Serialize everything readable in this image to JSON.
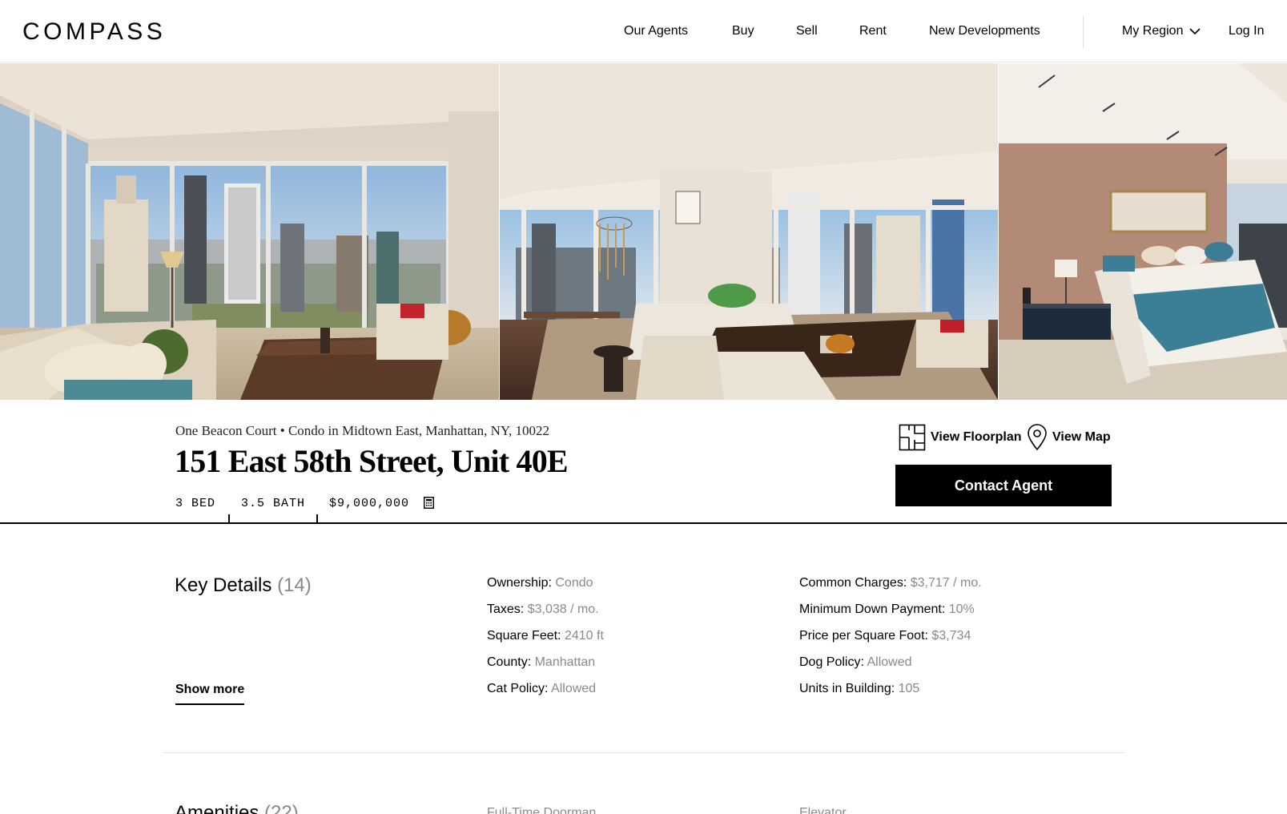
{
  "header": {
    "logo": "COMPASS",
    "nav": [
      "Our Agents",
      "Buy",
      "Sell",
      "Rent",
      "New Developments"
    ],
    "region_label": "My Region",
    "login_label": "Log In"
  },
  "listing": {
    "subline": "One Beacon Court • Condo in Midtown East, Manhattan, NY, 10022",
    "address": "151 East 58th Street, Unit 40E",
    "beds": "3 BED",
    "baths": "3.5 BATH",
    "price": "$9,000,000",
    "floorplan_label": "View Floorplan",
    "map_label": "View Map",
    "contact_label": "Contact Agent"
  },
  "key_details": {
    "title": "Key Details",
    "count": "(14)",
    "show_more": "Show more",
    "col1": [
      {
        "label": "Ownership:",
        "value": "Condo"
      },
      {
        "label": "Taxes:",
        "value": "$3,038 / mo."
      },
      {
        "label": "Square Feet:",
        "value": "2410 ft"
      },
      {
        "label": "County:",
        "value": "Manhattan"
      },
      {
        "label": "Cat Policy:",
        "value": "Allowed"
      }
    ],
    "col2": [
      {
        "label": "Common Charges:",
        "value": "$3,717 / mo."
      },
      {
        "label": "Minimum Down Payment:",
        "value": "10%"
      },
      {
        "label": "Price per Square Foot:",
        "value": "$3,734"
      },
      {
        "label": "Dog Policy:",
        "value": "Allowed"
      },
      {
        "label": "Units in Building:",
        "value": "105"
      }
    ]
  },
  "amenities": {
    "title": "Amenities",
    "count": "(22)",
    "items": [
      "Full-Time Doorman",
      "Elevator"
    ]
  },
  "icons": {
    "floorplan": "floorplan-icon",
    "map": "map-pin-icon",
    "calculator": "calculator-icon",
    "region_chevron": "chevron-down-icon"
  },
  "colors": {
    "primary": "#000000",
    "muted_text": "#8a8a8a",
    "background": "#ffffff"
  }
}
